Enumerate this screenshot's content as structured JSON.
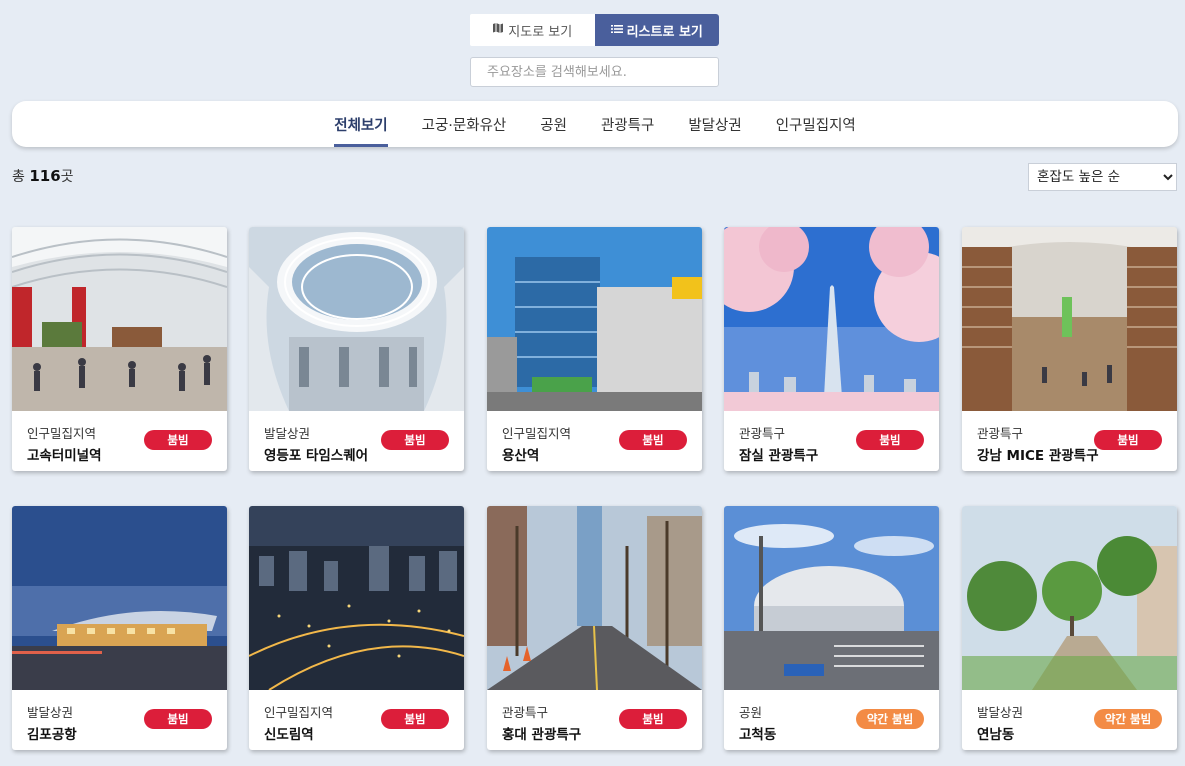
{
  "view_toggle": {
    "map_label": "지도로 보기",
    "list_label": "리스트로 보기"
  },
  "search": {
    "placeholder": "주요장소를 검색해보세요."
  },
  "categories": [
    "전체보기",
    "고궁·문화유산",
    "공원",
    "관광특구",
    "발달상권",
    "인구밀집지역"
  ],
  "count": {
    "prefix": "총 ",
    "value": "116",
    "suffix": "곳"
  },
  "sort": {
    "selected": "혼잡도 높은 순"
  },
  "places": [
    {
      "category": "인구밀집지역",
      "name": "고속터미널역",
      "status": "붐빔",
      "level": "busy",
      "scene": "terminal"
    },
    {
      "category": "발달상권",
      "name": "영등포 타임스퀘어",
      "status": "붐빔",
      "level": "busy",
      "scene": "atrium"
    },
    {
      "category": "인구밀집지역",
      "name": "용산역",
      "status": "붐빔",
      "level": "busy",
      "scene": "station"
    },
    {
      "category": "관광특구",
      "name": "잠실 관광특구",
      "status": "붐빔",
      "level": "busy",
      "scene": "tower"
    },
    {
      "category": "관광특구",
      "name": "강남 MICE 관광특구",
      "status": "붐빔",
      "level": "busy",
      "scene": "library"
    },
    {
      "category": "발달상권",
      "name": "김포공항",
      "status": "붐빔",
      "level": "busy",
      "scene": "airport"
    },
    {
      "category": "인구밀집지역",
      "name": "신도림역",
      "status": "붐빔",
      "level": "busy",
      "scene": "night"
    },
    {
      "category": "관광특구",
      "name": "홍대 관광특구",
      "status": "붐빔",
      "level": "busy",
      "scene": "street"
    },
    {
      "category": "공원",
      "name": "고척동",
      "status": "약간 붐빔",
      "level": "mid",
      "scene": "dome"
    },
    {
      "category": "발달상권",
      "name": "연남동",
      "status": "약간 붐빔",
      "level": "mid",
      "scene": "park"
    }
  ],
  "colors": {
    "accent": "#4a5f9c",
    "busy": "#dc1e3a",
    "slightly_busy": "#f38b45",
    "background": "#e6ecf4"
  }
}
